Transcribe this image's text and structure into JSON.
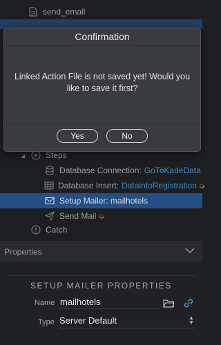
{
  "tree": {
    "items": [
      {
        "label": "send_email"
      },
      {
        "label": "Steps"
      },
      {
        "label": "Database Connection:",
        "link": "GoToKadeData"
      },
      {
        "label": "Database Insert:",
        "link": "DataintoRegistration"
      },
      {
        "label": "Setup Mailer: mailhotels"
      },
      {
        "label": "Send Mail"
      },
      {
        "label": "Catch"
      }
    ],
    "accent": "#2b5d9e",
    "link_color": "#4aa3e6",
    "warn_color": "#d9732c"
  },
  "dialog": {
    "title": "Confirmation",
    "message": "Linked Action File is not saved yet! Would you like to save it first?",
    "yes_label": "Yes",
    "no_label": "No"
  },
  "properties": {
    "header_label": "Properties",
    "section_title": "SETUP MAILER PROPERTIES",
    "name_label": "Name",
    "name_value": "mailhotels",
    "type_label": "Type",
    "type_value": "Server Default"
  }
}
